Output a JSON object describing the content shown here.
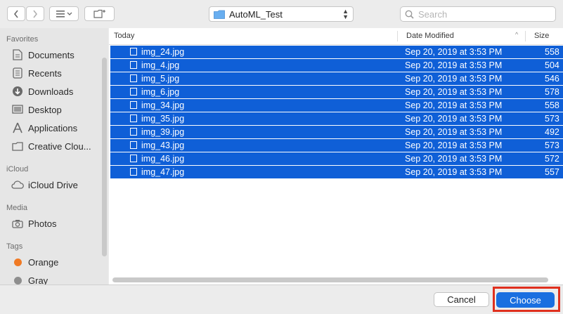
{
  "toolbar": {
    "path_label": "AutoML_Test",
    "search_placeholder": "Search"
  },
  "sidebar": {
    "sections": {
      "favorites": "Favorites",
      "icloud": "iCloud",
      "media": "Media",
      "tags": "Tags"
    },
    "favorites": [
      "Documents",
      "Recents",
      "Downloads",
      "Desktop",
      "Applications",
      "Creative Clou..."
    ],
    "icloud_items": [
      "iCloud Drive"
    ],
    "media_items": [
      "Photos"
    ],
    "tags": [
      {
        "label": "Orange",
        "color": "#f07a24"
      },
      {
        "label": "Gray",
        "color": "#8e8e8e"
      }
    ]
  },
  "filelist": {
    "columns": {
      "name": "Today",
      "date": "Date Modified",
      "size": "Size"
    },
    "rows": [
      {
        "name": "img_24.jpg",
        "date": "Sep 20, 2019 at 3:53 PM",
        "size": "558"
      },
      {
        "name": "img_4.jpg",
        "date": "Sep 20, 2019 at 3:53 PM",
        "size": "504"
      },
      {
        "name": "img_5.jpg",
        "date": "Sep 20, 2019 at 3:53 PM",
        "size": "546"
      },
      {
        "name": "img_6.jpg",
        "date": "Sep 20, 2019 at 3:53 PM",
        "size": "578"
      },
      {
        "name": "img_34.jpg",
        "date": "Sep 20, 2019 at 3:53 PM",
        "size": "558"
      },
      {
        "name": "img_35.jpg",
        "date": "Sep 20, 2019 at 3:53 PM",
        "size": "573"
      },
      {
        "name": "img_39.jpg",
        "date": "Sep 20, 2019 at 3:53 PM",
        "size": "492"
      },
      {
        "name": "img_43.jpg",
        "date": "Sep 20, 2019 at 3:53 PM",
        "size": "573"
      },
      {
        "name": "img_46.jpg",
        "date": "Sep 20, 2019 at 3:53 PM",
        "size": "572"
      },
      {
        "name": "img_47.jpg",
        "date": "Sep 20, 2019 at 3:53 PM",
        "size": "557"
      }
    ]
  },
  "buttons": {
    "cancel": "Cancel",
    "choose": "Choose"
  },
  "colors": {
    "selection": "#0f5fd7",
    "choose_button": "#1a6fe0",
    "highlight_frame": "#e0301e"
  }
}
